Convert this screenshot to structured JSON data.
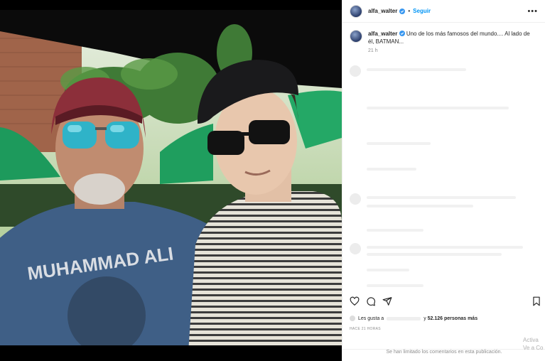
{
  "header": {
    "username": "alfa_walter",
    "follow_label": "Seguir",
    "separator": "•",
    "more_label": "•••"
  },
  "caption": {
    "username": "alfa_walter",
    "text": "Uno de los más famosos del mundo.... Al lado de él, BATMAN...",
    "time": "21 h"
  },
  "likes": {
    "prefix": "Les gusta a",
    "suffix": "y",
    "count": "52.126 personas más"
  },
  "post_age": "HACE 21 HORAS",
  "comments_limited": "Se han limitado los comentarios en esta publicación.",
  "watermark": {
    "line1": "Activa",
    "line2": "Ve a Co"
  },
  "photo": {
    "shirt_text": "MUHAMMAD ALI"
  },
  "colors": {
    "accent": "#0095f6",
    "text": "#262626",
    "muted": "#8e8e8e"
  },
  "icons": [
    "verified-badge-icon",
    "more-options-icon",
    "heart-icon",
    "comment-icon",
    "share-icon",
    "bookmark-icon"
  ]
}
